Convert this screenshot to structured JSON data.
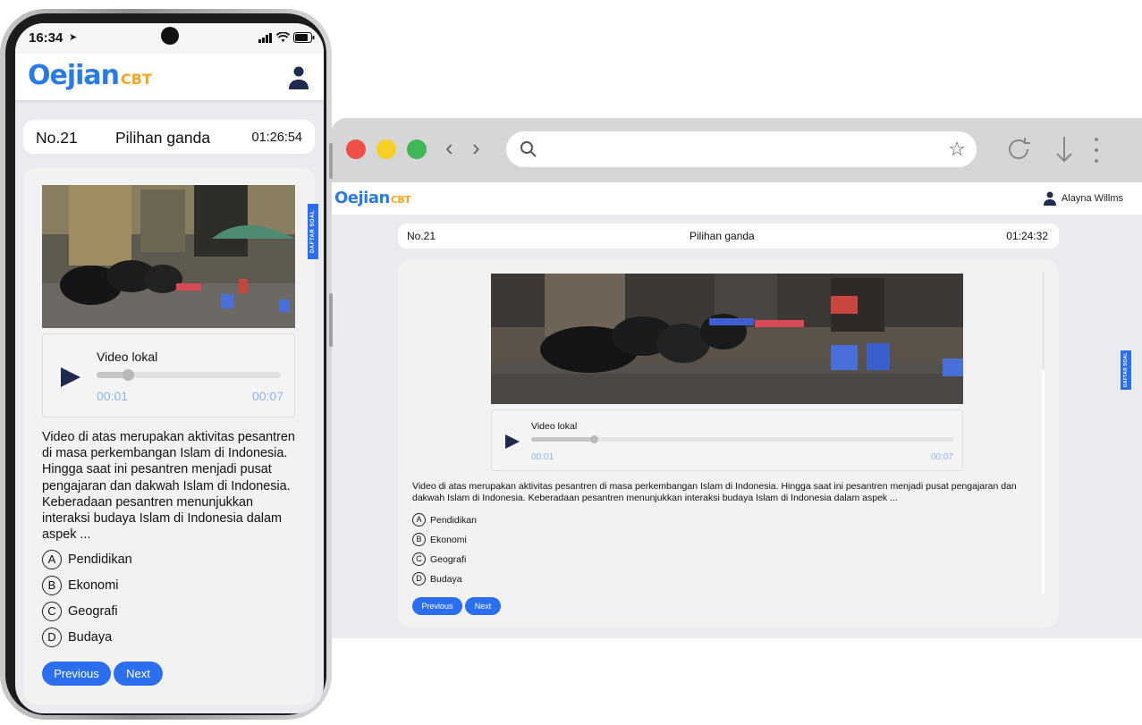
{
  "app": {
    "logo_main": "Oejian",
    "logo_sub": "CBT"
  },
  "phone": {
    "status_time": "16:34",
    "question_number": "No.21",
    "question_type": "Pilihan ganda",
    "timer": "01:26:54",
    "daftar_soal": "DAFTAR SOAL",
    "video_title": "Video lokal",
    "video_current": "00:01",
    "video_total": "00:07",
    "video_progress": 0.17,
    "question_text": "Video di atas merupakan aktivitas pesantren di masa perkembangan Islam di Indonesia. Hingga saat ini pesantren menjadi pusat pengajaran dan dakwah Islam di Indonesia. Keberadaan pesantren menunjukkan interaksi budaya Islam di Indonesia dalam aspek ...",
    "options": [
      {
        "letter": "A",
        "text": "Pendidikan"
      },
      {
        "letter": "B",
        "text": "Ekonomi"
      },
      {
        "letter": "C",
        "text": "Geografi"
      },
      {
        "letter": "D",
        "text": "Budaya"
      }
    ],
    "previous_label": "Previous",
    "next_label": "Next"
  },
  "desktop": {
    "user_name": "Alayna Willms",
    "question_number": "No.21",
    "question_type": "Pilihan ganda",
    "timer": "01:24:32",
    "daftar_soal": "DAFTAR SOAL",
    "video_title": "Video lokal",
    "video_current": "00:01",
    "video_total": "00:07",
    "video_progress": 0.15,
    "question_text": "Video di atas merupakan aktivitas pesantren di masa perkembangan Islam di Indonesia. Hingga saat ini pesantren menjadi pusat pengajaran dan dakwah Islam di Indonesia. Keberadaan pesantren menunjukkan interaksi budaya Islam di Indonesia dalam aspek ...",
    "options": [
      {
        "letter": "A",
        "text": "Pendidikan"
      },
      {
        "letter": "B",
        "text": "Ekonomi"
      },
      {
        "letter": "C",
        "text": "Geografi"
      },
      {
        "letter": "D",
        "text": "Budaya"
      }
    ],
    "previous_label": "Previous",
    "next_label": "Next"
  },
  "colors": {
    "accent": "#2b6ff0",
    "logo_blue": "#2c7be5",
    "logo_orange": "#f5a623",
    "time_blue": "#8fb4ee",
    "play_dark": "#1f2a4d"
  },
  "icons": [
    "search-icon",
    "star-icon",
    "reload-icon",
    "download-icon",
    "more-icon",
    "user-icon",
    "play-icon",
    "signal-icon",
    "wifi-icon",
    "battery-icon",
    "location-arrow-icon"
  ]
}
